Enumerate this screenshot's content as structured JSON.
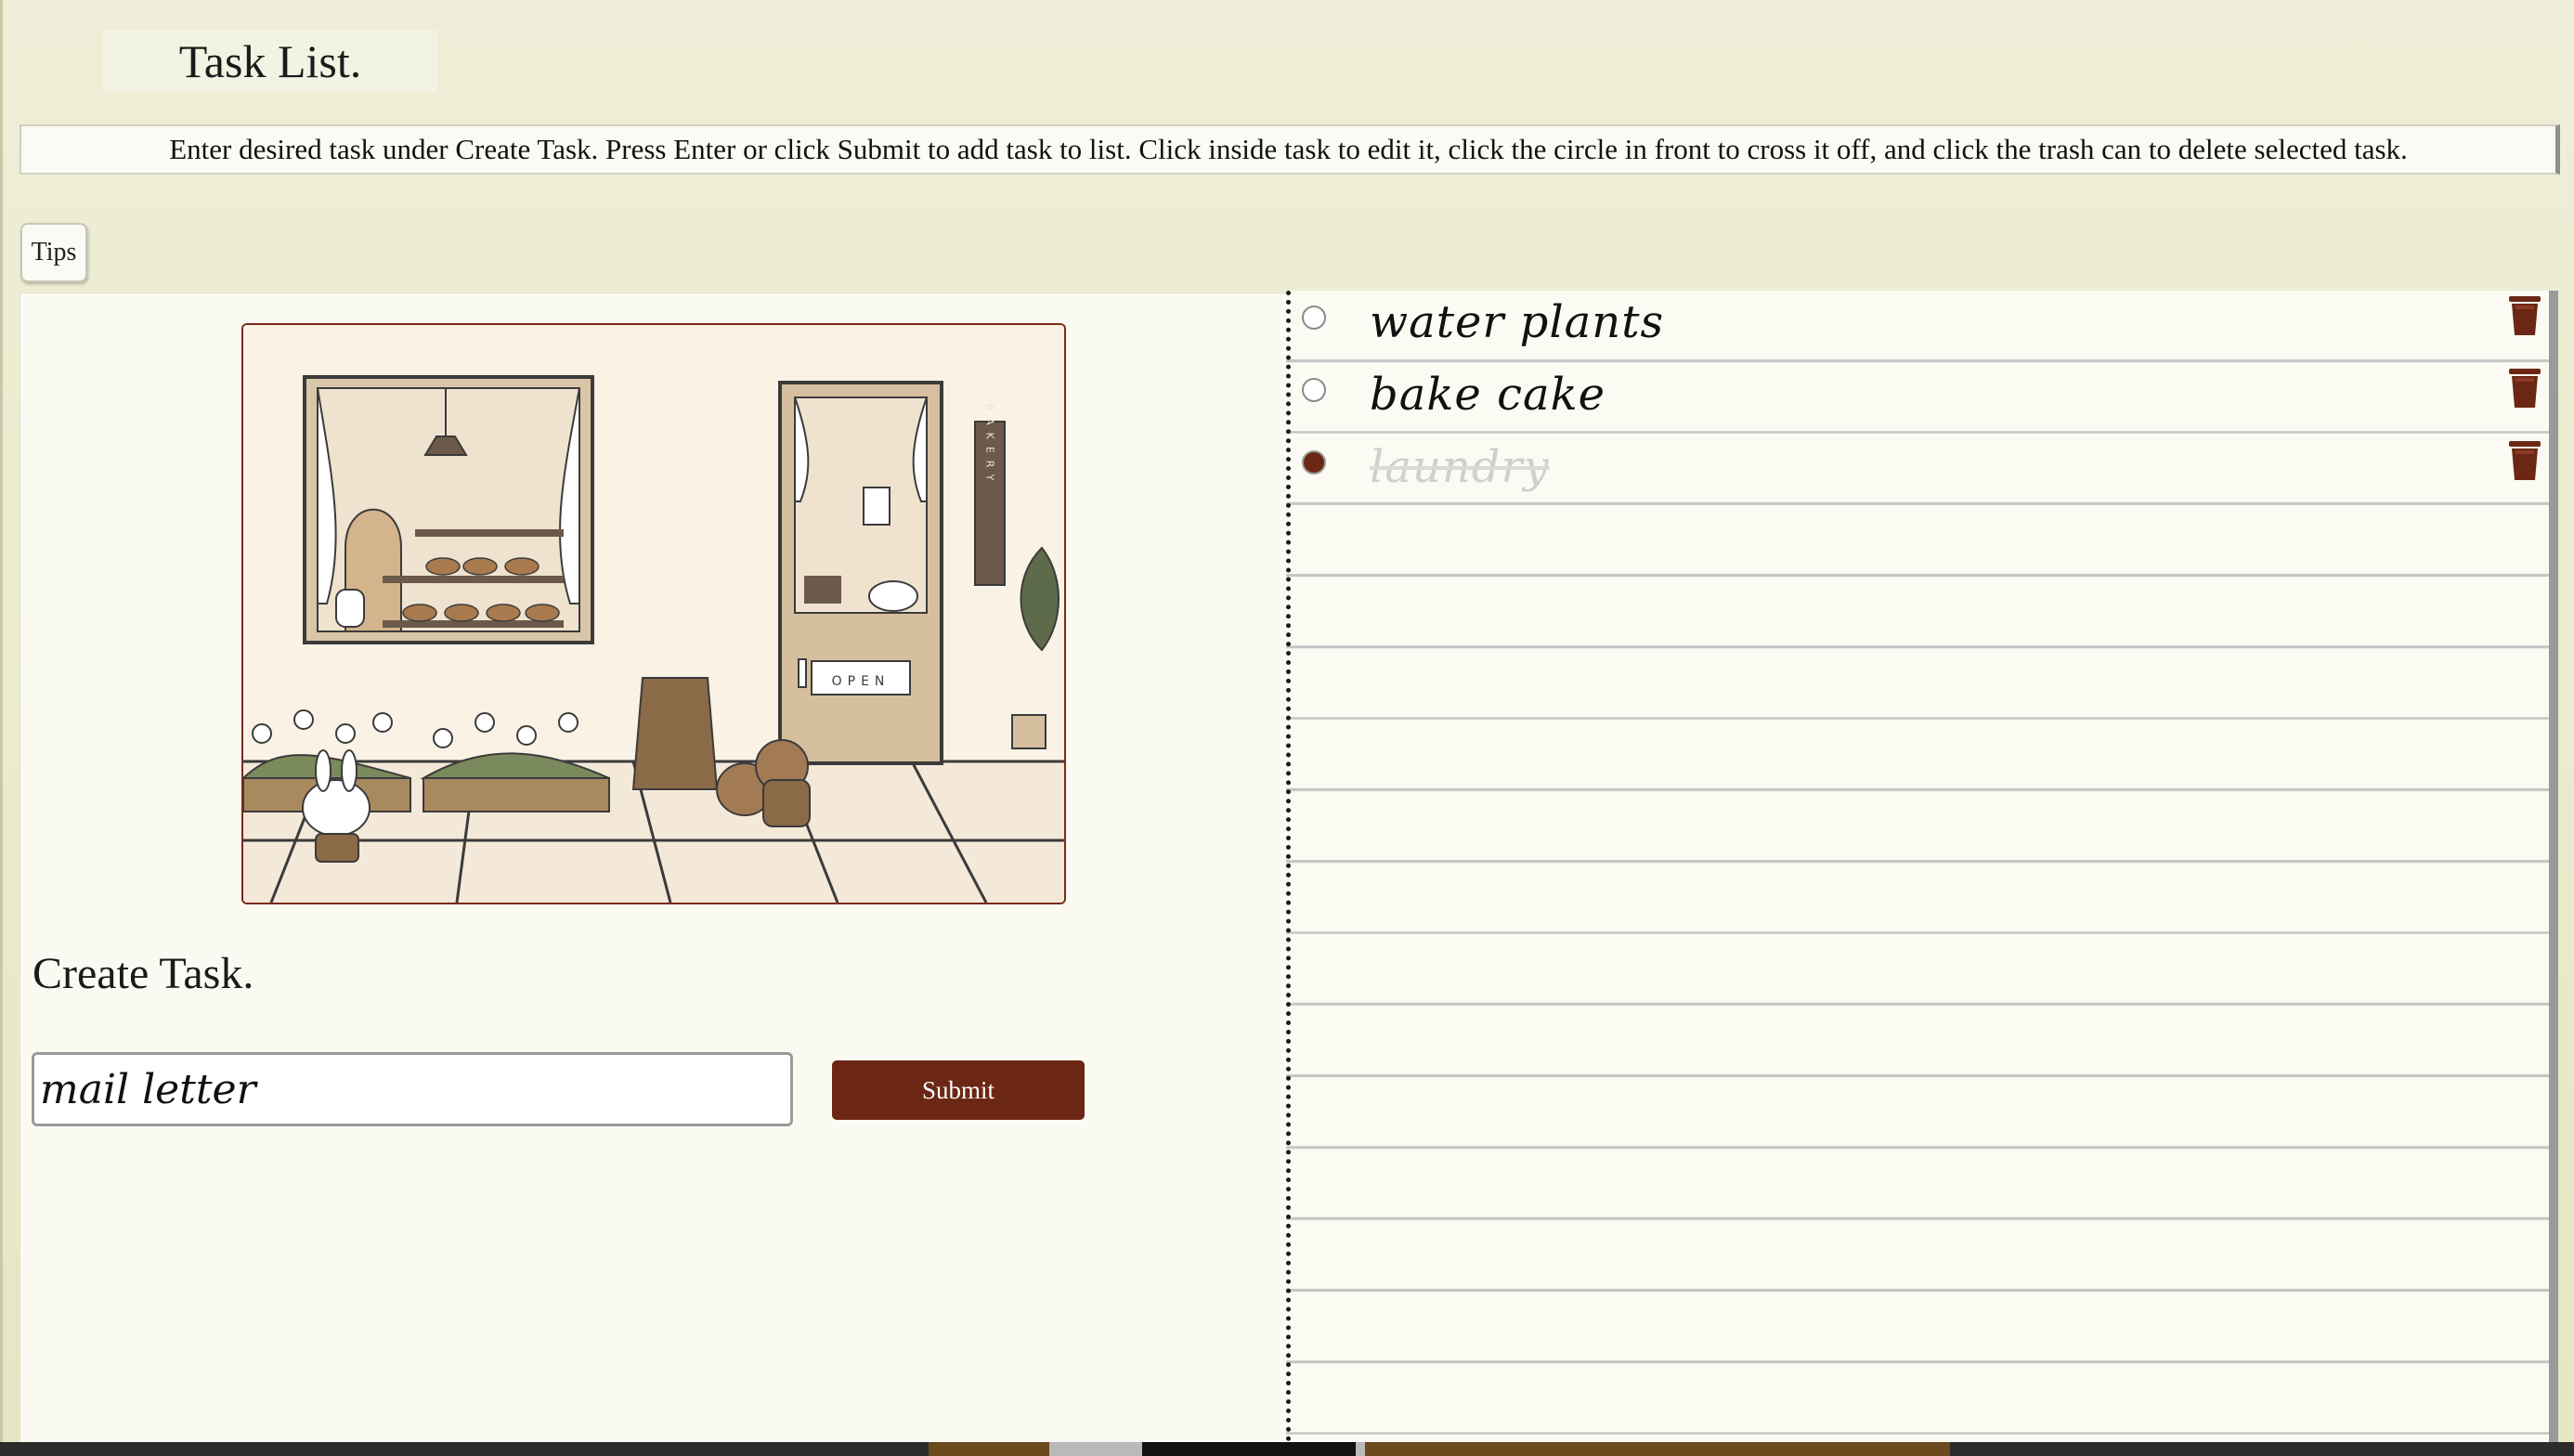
{
  "page": {
    "title": "Task List.",
    "instructions": "Enter desired task under Create Task. Press Enter or click Submit to add task to list. Click inside task to edit it, click the circle in front to cross it off, and click the trash can to delete selected task.",
    "tips_label": "Tips"
  },
  "illustration": {
    "sign_text": "BAKERY",
    "door_sign": "OPEN"
  },
  "create": {
    "heading": "Create Task.",
    "input_value": "mail letter",
    "submit_label": "Submit"
  },
  "tasks": [
    {
      "text": "water plants",
      "done": false
    },
    {
      "text": "bake cake",
      "done": false
    },
    {
      "text": "laundry",
      "done": true
    }
  ],
  "colors": {
    "accent": "#6c2714",
    "background": "#eeeed8",
    "panel": "#fbfaf2"
  },
  "icons": {
    "delete": "trash-icon",
    "toggle": "radio-circle-icon"
  }
}
